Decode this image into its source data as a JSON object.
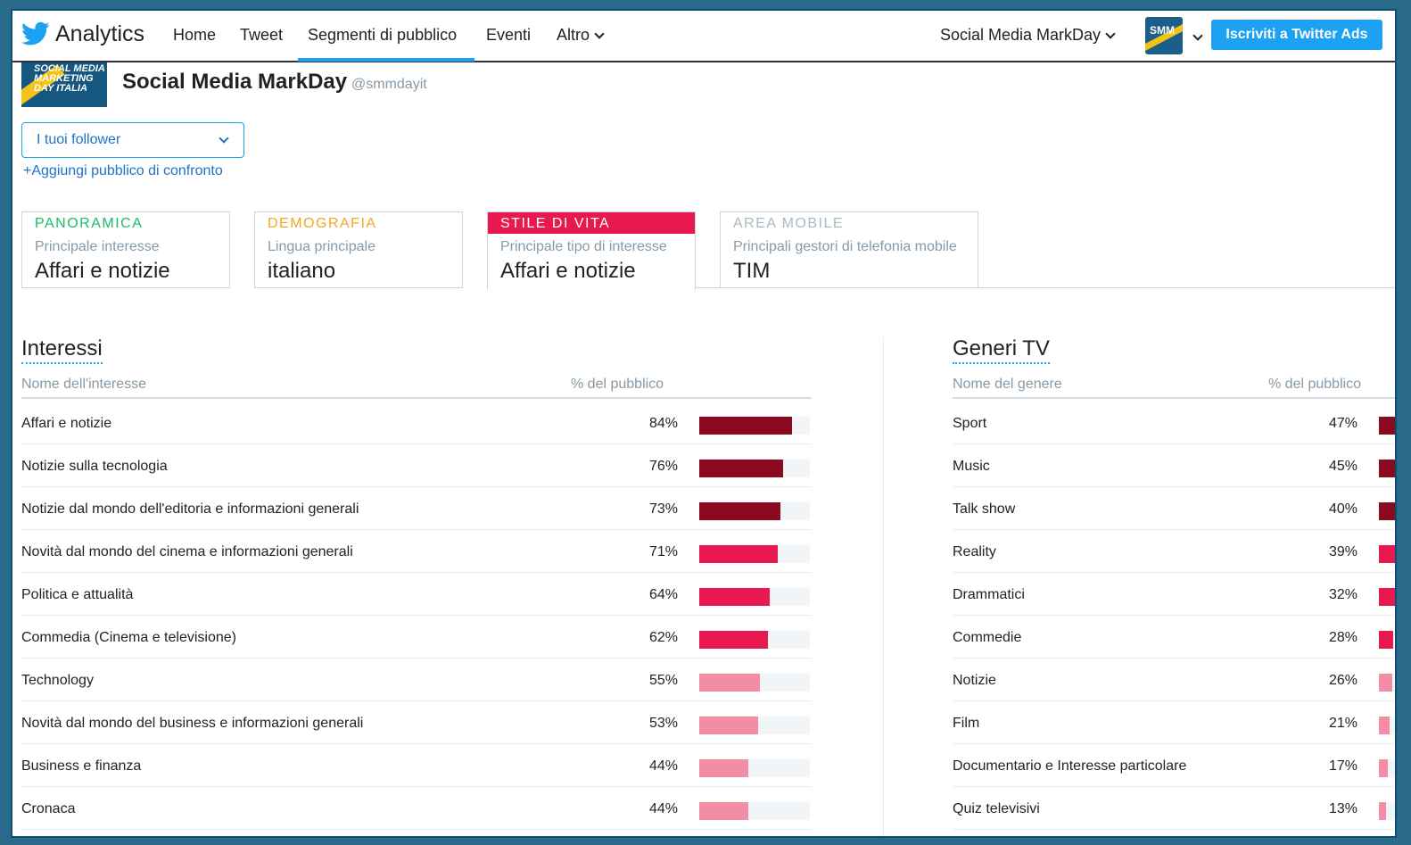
{
  "nav": {
    "brand": "Analytics",
    "items": [
      "Home",
      "Tweet",
      "Segmenti di pubblico",
      "Eventi",
      "Altro"
    ],
    "account": "Social Media MarkDay",
    "ads_button": "Iscriviti a Twitter Ads",
    "avatar_text": "SMM"
  },
  "profile": {
    "avatar_text": "SOCIAL MEDIA MARKETING DAY ITALIA",
    "name": "Social Media MarkDay",
    "handle": "@smmdayit",
    "audience_select": "I tuoi follower",
    "add_compare": "+Aggiungi pubblico di confronto"
  },
  "cards": [
    {
      "tag": "PANORAMICA",
      "sub": "Principale interesse",
      "value": "Affari e notizie",
      "color": "#17bf63"
    },
    {
      "tag": "DEMOGRAFIA",
      "sub": "Lingua principale",
      "value": "italiano",
      "color": "#f5a623"
    },
    {
      "tag": "STILE DI VITA",
      "sub": "Principale tipo di interesse",
      "value": "Affari e notizie",
      "color": "#ffffff"
    },
    {
      "tag": "AREA MOBILE",
      "sub": "Principali gestori di telefonia mobile",
      "value": "TIM",
      "color": "#aab8c2"
    }
  ],
  "interests": {
    "title": "Interessi",
    "col_name": "Nome dell'interesse",
    "col_pct": "% del pubblico",
    "rows": [
      {
        "name": "Affari e notizie",
        "pct": "84%",
        "value": 84,
        "color": "#8b0a20"
      },
      {
        "name": "Notizie sulla tecnologia",
        "pct": "76%",
        "value": 76,
        "color": "#8b0a20"
      },
      {
        "name": "Notizie dal mondo dell'editoria e informazioni generali",
        "pct": "73%",
        "value": 73,
        "color": "#8b0a20"
      },
      {
        "name": "Novità dal mondo del cinema e informazioni generali",
        "pct": "71%",
        "value": 71,
        "color": "#e8194f"
      },
      {
        "name": "Politica e attualità",
        "pct": "64%",
        "value": 64,
        "color": "#e8194f"
      },
      {
        "name": "Commedia (Cinema e televisione)",
        "pct": "62%",
        "value": 62,
        "color": "#e8194f"
      },
      {
        "name": "Technology",
        "pct": "55%",
        "value": 55,
        "color": "#f48ca6"
      },
      {
        "name": "Novità dal mondo del business e informazioni generali",
        "pct": "53%",
        "value": 53,
        "color": "#f48ca6"
      },
      {
        "name": "Business e finanza",
        "pct": "44%",
        "value": 44,
        "color": "#f48ca6"
      },
      {
        "name": "Cronaca",
        "pct": "44%",
        "value": 44,
        "color": "#f48ca6"
      }
    ]
  },
  "tv": {
    "title": "Generi TV",
    "col_name": "Nome del genere",
    "col_pct": "% del pubblico",
    "rows": [
      {
        "name": "Sport",
        "pct": "47%",
        "value": 47,
        "color": "#8b0a20"
      },
      {
        "name": "Music",
        "pct": "45%",
        "value": 45,
        "color": "#8b0a20"
      },
      {
        "name": "Talk show",
        "pct": "40%",
        "value": 40,
        "color": "#8b0a20"
      },
      {
        "name": "Reality",
        "pct": "39%",
        "value": 39,
        "color": "#e8194f"
      },
      {
        "name": "Drammatici",
        "pct": "32%",
        "value": 32,
        "color": "#e8194f"
      },
      {
        "name": "Commedie",
        "pct": "28%",
        "value": 28,
        "color": "#e8194f"
      },
      {
        "name": "Notizie",
        "pct": "26%",
        "value": 26,
        "color": "#f48ca6"
      },
      {
        "name": "Film",
        "pct": "21%",
        "value": 21,
        "color": "#f48ca6"
      },
      {
        "name": "Documentario e Interesse particolare",
        "pct": "17%",
        "value": 17,
        "color": "#f48ca6"
      },
      {
        "name": "Quiz televisivi",
        "pct": "13%",
        "value": 13,
        "color": "#f48ca6"
      }
    ]
  }
}
